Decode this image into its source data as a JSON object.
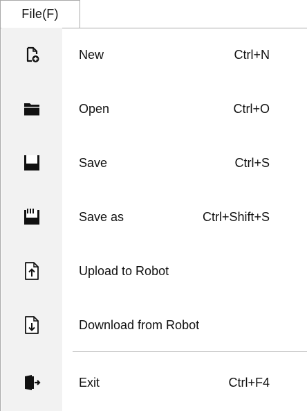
{
  "menubar": {
    "file_menu_title": "File(F)"
  },
  "menu": {
    "items": [
      {
        "label": "New",
        "shortcut": "Ctrl+N",
        "icon": "new-file-icon"
      },
      {
        "label": "Open",
        "shortcut": "Ctrl+O",
        "icon": "folder-open-icon"
      },
      {
        "label": "Save",
        "shortcut": "Ctrl+S",
        "icon": "save-icon"
      },
      {
        "label": "Save as",
        "shortcut": "Ctrl+Shift+S",
        "icon": "save-as-icon"
      },
      {
        "label": "Upload to Robot",
        "shortcut": "",
        "icon": "upload-icon"
      },
      {
        "label": "Download from Robot",
        "shortcut": "",
        "icon": "download-icon"
      },
      {
        "label": "Exit",
        "shortcut": "Ctrl+F4",
        "icon": "exit-icon"
      }
    ]
  },
  "colors": {
    "gutter": "#f2f2f2",
    "border": "#a9a9a9",
    "icon": "#111111"
  }
}
